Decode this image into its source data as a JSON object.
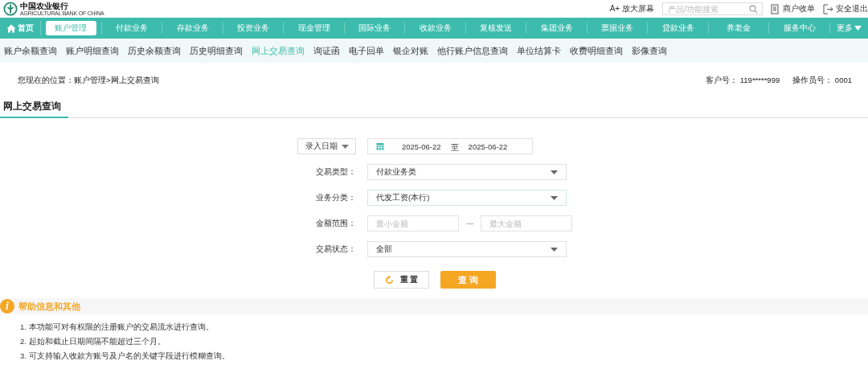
{
  "header": {
    "logo_name": "中国农业银行",
    "logo_subtitle": "AGRICULTURAL BANK OF CHINA",
    "zoom_link": "A+ 放大屏幕",
    "search": {
      "placeholder": "产品/功能搜索"
    },
    "links": [
      {
        "label": "商户收单",
        "kind": "doc"
      },
      {
        "label": "安全退出",
        "kind": "exit"
      }
    ]
  },
  "nav": [
    {
      "label": "首页",
      "kind": "home",
      "selected": false
    },
    {
      "label": "账户管理",
      "kind": "item",
      "selected": true
    },
    {
      "label": "付款业务",
      "kind": "item",
      "selected": false
    },
    {
      "label": "存款业务",
      "kind": "item",
      "selected": false
    },
    {
      "label": "投资业务",
      "kind": "item",
      "selected": false
    },
    {
      "label": "现金管理",
      "kind": "item",
      "selected": false
    },
    {
      "label": "国际业务",
      "kind": "item",
      "selected": false
    },
    {
      "label": "收款业务",
      "kind": "item",
      "selected": false
    },
    {
      "label": "复核发送",
      "kind": "item",
      "selected": false
    },
    {
      "label": "集团业务",
      "kind": "item",
      "selected": false
    },
    {
      "label": "票据业务",
      "kind": "item",
      "selected": false
    },
    {
      "label": "贷款业务",
      "kind": "item",
      "selected": false
    },
    {
      "label": "养老金",
      "kind": "item",
      "selected": false
    },
    {
      "label": "服务中心",
      "kind": "item",
      "selected": false
    },
    {
      "label": "更多",
      "kind": "more",
      "selected": false
    }
  ],
  "subnav": [
    {
      "label": "账户余额查询",
      "selected": false
    },
    {
      "label": "账户明细查询",
      "selected": false
    },
    {
      "label": "历史余额查询",
      "selected": false
    },
    {
      "label": "历史明细查询",
      "selected": false
    },
    {
      "label": "网上交易查询",
      "selected": true
    },
    {
      "label": "询证函",
      "selected": false
    },
    {
      "label": "电子回单",
      "selected": false
    },
    {
      "label": "银企对账",
      "selected": false
    },
    {
      "label": "他行账户信息查询",
      "selected": false
    },
    {
      "label": "单位结算卡",
      "selected": false
    },
    {
      "label": "收费明细查询",
      "selected": false
    },
    {
      "label": "影像查询",
      "selected": false
    }
  ],
  "breadcrumb": "您现在的位置：账户管理>网上交易查询",
  "customer": {
    "label": "客户号：",
    "value": "119*****999"
  },
  "operator": {
    "label": "操作员号：",
    "value": "0001"
  },
  "page_title": "网上交易查询",
  "form": {
    "date_type": "录入日期",
    "date_from": "2025-06-22",
    "date_separator": "至",
    "date_to": "2025-06-22",
    "rows": [
      {
        "kind": "select",
        "label": "交易类型：",
        "value": "付款业务类"
      },
      {
        "kind": "select",
        "label": "业务分类：",
        "value": "代发工资(本行)"
      },
      {
        "kind": "range",
        "label": "金额范围：",
        "min_placeholder": "最小金额",
        "separator": "—",
        "max_placeholder": "最大金额"
      },
      {
        "kind": "select",
        "label": "交易状态：",
        "value": "全部"
      }
    ],
    "reset_button": "重 置",
    "query_button": "查 询"
  },
  "help": {
    "icon_text": "i",
    "title": "帮助信息和其他",
    "items": [
      "1. 本功能可对有权限的注册账户的交易流水进行查询。",
      "2. 起始和截止日期间隔不能超过三个月。",
      "3. 可支持输入收款方账号及户名的关键字段进行模糊查询。"
    ]
  }
}
